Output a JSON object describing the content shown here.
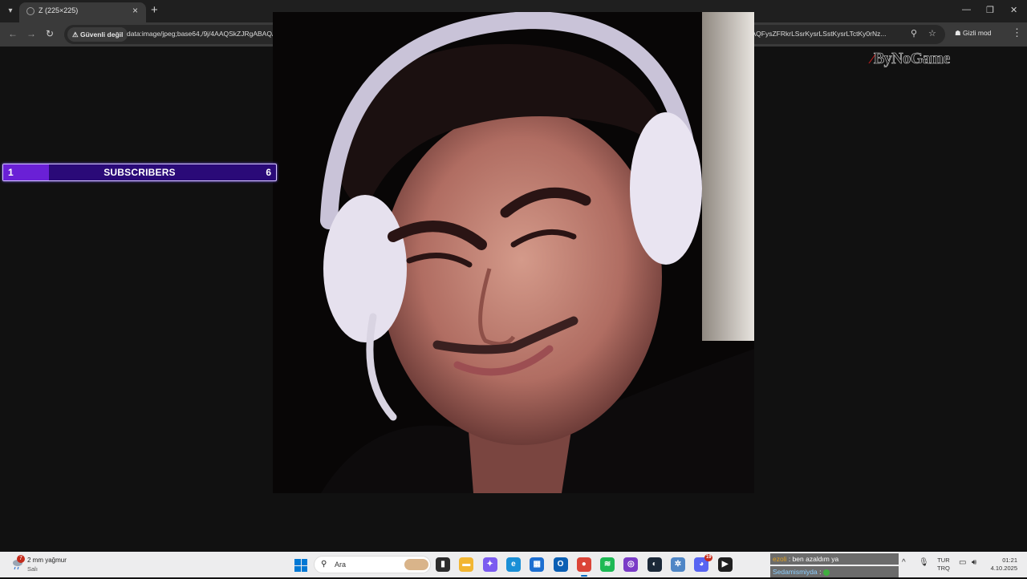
{
  "browser": {
    "tab_title": "Z (225×225)",
    "tab_search_icon": "▾",
    "new_tab_label": "+",
    "security_label": "Güvenli değil",
    "url": "data:image/jpeg;base64,/9j/4AAQSkZJRgABAQAAAQABAAD/2wCEAAkGBxAQEg8PEBAQEBAQDQ8PDQ8PDw8PDQ8PFREWFhURFRUYHSggGBolGxUVITEhJSkrLi4uFx8zODMsNygtLisBCgoKDg0OFRAQFysZFRkrLSsrKysrLSstKysrLTctKy0rNz...",
    "incognito_label": "Gizli mod",
    "icons": {
      "back": "arrow-left-icon",
      "forward": "arrow-right-icon",
      "reload": "reload-icon",
      "zoom": "zoom-icon",
      "bookmark": "star-icon",
      "menu": "kebab-icon"
    }
  },
  "stream": {
    "brand_logo_text": "ByNoGame",
    "subscriber_bar": {
      "current": "1",
      "label": "SUBSCRIBERS",
      "goal": "6",
      "progress_fraction": 0.167,
      "fill_color": "#6a20d6",
      "bar_color": "#2a0a78"
    },
    "chat": [
      {
        "user": "ezoli",
        "message": ": ben azaldım ya"
      },
      {
        "user": "Sedamismiyda",
        "message": ":"
      }
    ]
  },
  "taskbar": {
    "weather_badge": "7",
    "weather_temp": "2 mm yağmur",
    "weather_day": "Salı",
    "search_placeholder": "Ara",
    "apps": [
      {
        "name": "file-manager",
        "glyph": "▮",
        "color": "#2b2b2b"
      },
      {
        "name": "folder",
        "glyph": "▬",
        "color": "#f2b632"
      },
      {
        "name": "copilot",
        "glyph": "✦",
        "color": "#7b5cf0"
      },
      {
        "name": "edge",
        "glyph": "e",
        "color": "#1a8fd6"
      },
      {
        "name": "store",
        "glyph": "▦",
        "color": "#1d6fd1"
      },
      {
        "name": "outlook",
        "glyph": "O",
        "color": "#0a5fb4"
      },
      {
        "name": "chrome",
        "glyph": "●",
        "color": "#db4437"
      },
      {
        "name": "spotify",
        "glyph": "≋",
        "color": "#1db954"
      },
      {
        "name": "obs",
        "glyph": "◎",
        "color": "#7a3cc7"
      },
      {
        "name": "steam",
        "glyph": "◐",
        "color": "#1b2838"
      },
      {
        "name": "settings",
        "glyph": "✲",
        "color": "#4f86c6"
      },
      {
        "name": "discord",
        "glyph": "◕",
        "color": "#5865f2",
        "badge": "19"
      },
      {
        "name": "media-player",
        "glyph": "▶",
        "color": "#1f1f1f"
      }
    ],
    "lang_top": "TUR",
    "lang_bottom": "TRQ",
    "time": "01:21",
    "date": "4.10.2025"
  }
}
